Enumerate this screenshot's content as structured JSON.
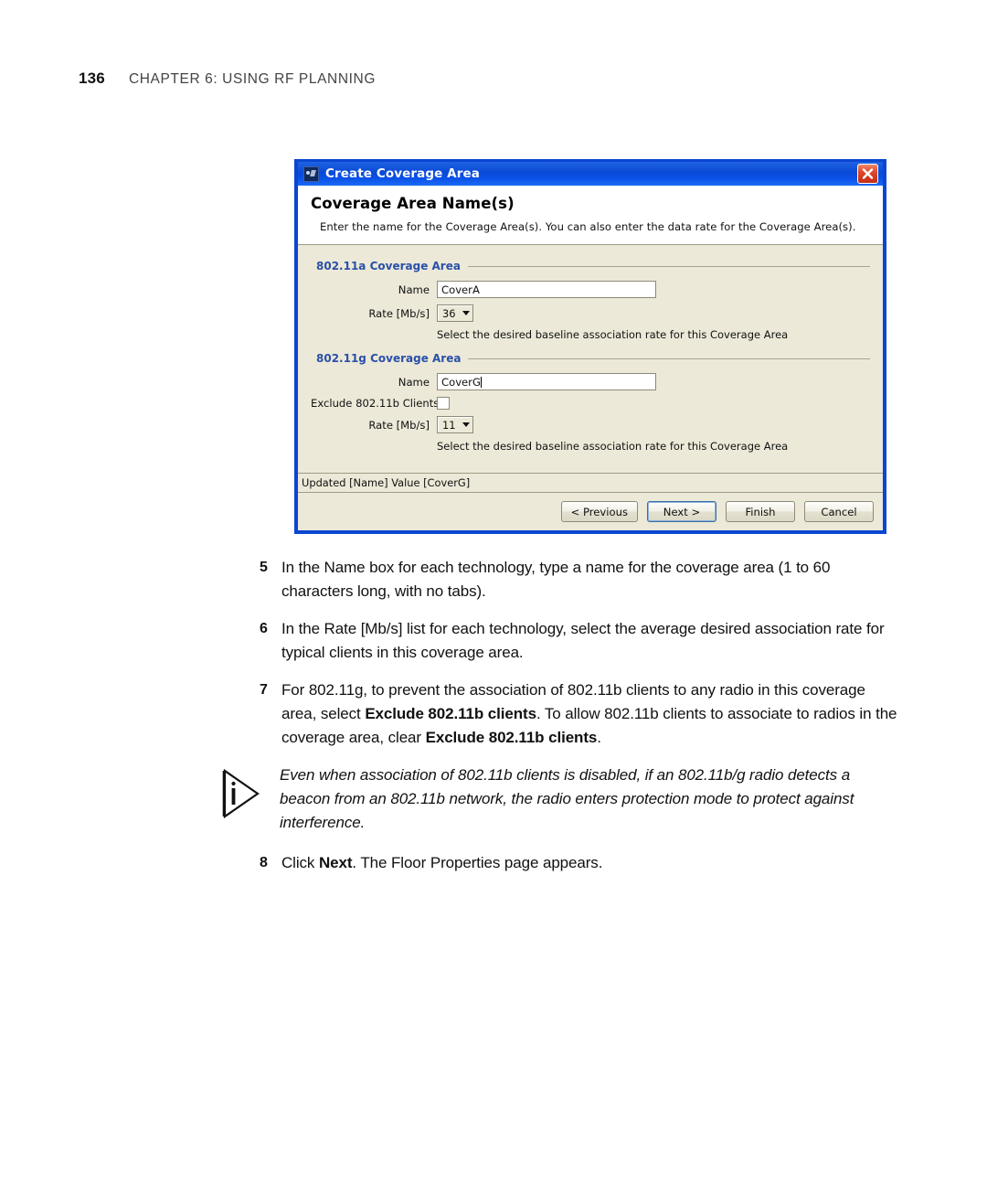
{
  "page": {
    "number": "136",
    "chapter": "CHAPTER 6: USING RF PLANNING"
  },
  "dialog": {
    "titlebar": {
      "title": "Create Coverage Area",
      "icon": "app-icon",
      "close_label": "×"
    },
    "header": {
      "heading": "Coverage Area Name(s)",
      "description": "Enter the name for the Coverage Area(s). You can also enter the data rate for the Coverage Area(s)."
    },
    "groups": [
      {
        "title": "802.11a Coverage Area",
        "name_label": "Name",
        "name_value": "CoverA",
        "rate_label": "Rate [Mb/s]",
        "rate_value": "36",
        "hint": "Select the desired baseline association rate for this Coverage Area"
      },
      {
        "title": "802.11g Coverage Area",
        "name_label": "Name",
        "name_value": "CoverG",
        "exclude_label": "Exclude 802.11b Clients",
        "exclude_checked": false,
        "rate_label": "Rate [Mb/s]",
        "rate_value": "11",
        "hint": "Select the desired baseline association rate for this Coverage Area"
      }
    ],
    "status": "Updated [Name] Value [CoverG]",
    "buttons": {
      "previous": "< Previous",
      "next": "Next >",
      "finish": "Finish",
      "cancel": "Cancel"
    },
    "colors": {
      "titlebar_blue": "#0a4ad6",
      "border_blue": "#0a46d2",
      "panel_beige": "#ece9d8",
      "group_label_blue": "#2a50a8",
      "close_red": "#c52d16"
    }
  },
  "steps": [
    {
      "num": "5",
      "text_html": "In the Name box for each technology, type a name for the coverage area (1 to 60 characters long, with no tabs)."
    },
    {
      "num": "6",
      "text_html": "In the Rate [Mb/s] list for each technology, select the average desired association rate for typical clients in this coverage area."
    },
    {
      "num": "7",
      "text_html": "For 802.11g, to prevent the association of 802.11b clients to any radio in this coverage area, select <b>Exclude 802.11b clients</b>. To allow 802.11b clients to associate to radios in the coverage area, clear <b>Exclude 802.11b clients</b>."
    }
  ],
  "note": {
    "icon": "info-note-icon",
    "text": "Even when association of 802.11b clients is disabled, if an 802.11b/g radio detects a beacon from an 802.11b network, the radio enters protection mode to protect against interference."
  },
  "final_step": {
    "num": "8",
    "text_html": "Click <b>Next</b>. The Floor Properties page appears."
  }
}
